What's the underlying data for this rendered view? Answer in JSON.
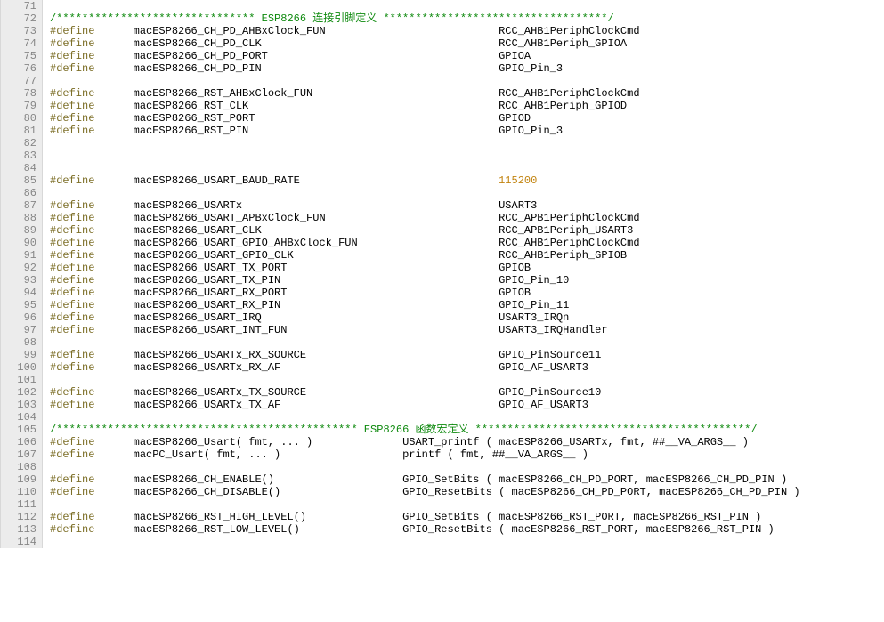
{
  "first_line": 71,
  "lines": [
    {
      "n": 71,
      "raw": ""
    },
    {
      "n": 72,
      "comment": "/******************************* ESP8266 连接引脚定义 ***********************************/"
    },
    {
      "n": 73,
      "def": true,
      "c1": "macESP8266_CH_PD_AHBxClock_FUN",
      "c2": "RCC_AHB1PeriphClockCmd"
    },
    {
      "n": 74,
      "def": true,
      "c1": "macESP8266_CH_PD_CLK",
      "c2": "RCC_AHB1Periph_GPIOA"
    },
    {
      "n": 75,
      "def": true,
      "c1": "macESP8266_CH_PD_PORT",
      "c2": "GPIOA"
    },
    {
      "n": 76,
      "def": true,
      "c1": "macESP8266_CH_PD_PIN",
      "c2": "GPIO_Pin_3"
    },
    {
      "n": 77,
      "raw": ""
    },
    {
      "n": 78,
      "def": true,
      "c1": "macESP8266_RST_AHBxClock_FUN",
      "c2": "RCC_AHB1PeriphClockCmd"
    },
    {
      "n": 79,
      "def": true,
      "c1": "macESP8266_RST_CLK",
      "c2": "RCC_AHB1Periph_GPIOD"
    },
    {
      "n": 80,
      "def": true,
      "c1": "macESP8266_RST_PORT",
      "c2": "GPIOD"
    },
    {
      "n": 81,
      "def": true,
      "c1": "macESP8266_RST_PIN",
      "c2": "GPIO_Pin_3"
    },
    {
      "n": 82,
      "raw": ""
    },
    {
      "n": 83,
      "raw": ""
    },
    {
      "n": 84,
      "raw": ""
    },
    {
      "n": 85,
      "def": true,
      "c1": "macESP8266_USART_BAUD_RATE",
      "c2": "115200",
      "num": true
    },
    {
      "n": 86,
      "raw": ""
    },
    {
      "n": 87,
      "def": true,
      "c1": "macESP8266_USARTx",
      "c2": "USART3"
    },
    {
      "n": 88,
      "def": true,
      "c1": "macESP8266_USART_APBxClock_FUN",
      "c2": "RCC_APB1PeriphClockCmd"
    },
    {
      "n": 89,
      "def": true,
      "c1": "macESP8266_USART_CLK",
      "c2": "RCC_APB1Periph_USART3"
    },
    {
      "n": 90,
      "def": true,
      "c1": "macESP8266_USART_GPIO_AHBxClock_FUN",
      "c2": "RCC_AHB1PeriphClockCmd"
    },
    {
      "n": 91,
      "def": true,
      "c1": "macESP8266_USART_GPIO_CLK",
      "c2": "RCC_AHB1Periph_GPIOB"
    },
    {
      "n": 92,
      "def": true,
      "c1": "macESP8266_USART_TX_PORT",
      "c2": "GPIOB"
    },
    {
      "n": 93,
      "def": true,
      "c1": "macESP8266_USART_TX_PIN",
      "c2": "GPIO_Pin_10"
    },
    {
      "n": 94,
      "def": true,
      "c1": "macESP8266_USART_RX_PORT",
      "c2": "GPIOB"
    },
    {
      "n": 95,
      "def": true,
      "c1": "macESP8266_USART_RX_PIN",
      "c2": "GPIO_Pin_11"
    },
    {
      "n": 96,
      "def": true,
      "c1": "macESP8266_USART_IRQ",
      "c2": "USART3_IRQn"
    },
    {
      "n": 97,
      "def": true,
      "c1": "macESP8266_USART_INT_FUN",
      "c2": "USART3_IRQHandler"
    },
    {
      "n": 98,
      "raw": ""
    },
    {
      "n": 99,
      "def": true,
      "c1": "macESP8266_USARTx_RX_SOURCE",
      "c2": "GPIO_PinSource11"
    },
    {
      "n": 100,
      "def": true,
      "c1": "macESP8266_USARTx_RX_AF",
      "c2": "GPIO_AF_USART3"
    },
    {
      "n": 101,
      "raw": ""
    },
    {
      "n": 102,
      "def": true,
      "c1": "macESP8266_USARTx_TX_SOURCE",
      "c2": "GPIO_PinSource10"
    },
    {
      "n": 103,
      "def": true,
      "c1": "macESP8266_USARTx_TX_AF",
      "c2": "GPIO_AF_USART3"
    },
    {
      "n": 104,
      "raw": ""
    },
    {
      "n": 105,
      "comment": "/*********************************************** ESP8266 函数宏定义 *******************************************/"
    },
    {
      "n": 106,
      "def": true,
      "c1": "macESP8266_Usart( fmt, ... )",
      "c2": "USART_printf ( macESP8266_USARTx, fmt, ##__VA_ARGS__ )",
      "col2": 55
    },
    {
      "n": 107,
      "def": true,
      "c1": "macPC_Usart( fmt, ... )",
      "c2": "printf ( fmt, ##__VA_ARGS__ )",
      "col2": 55
    },
    {
      "n": 108,
      "raw": ""
    },
    {
      "n": 109,
      "def": true,
      "c1": "macESP8266_CH_ENABLE()",
      "c2": "GPIO_SetBits ( macESP8266_CH_PD_PORT, macESP8266_CH_PD_PIN )",
      "col2": 55
    },
    {
      "n": 110,
      "def": true,
      "c1": "macESP8266_CH_DISABLE()",
      "c2": "GPIO_ResetBits ( macESP8266_CH_PD_PORT, macESP8266_CH_PD_PIN )",
      "col2": 55
    },
    {
      "n": 111,
      "raw": ""
    },
    {
      "n": 112,
      "def": true,
      "c1": "macESP8266_RST_HIGH_LEVEL()",
      "c2": "GPIO_SetBits ( macESP8266_RST_PORT, macESP8266_RST_PIN )",
      "col2": 55
    },
    {
      "n": 113,
      "def": true,
      "c1": "macESP8266_RST_LOW_LEVEL()",
      "c2": "GPIO_ResetBits ( macESP8266_RST_PORT, macESP8266_RST_PIN )",
      "col2": 55
    },
    {
      "n": 114,
      "raw": ""
    }
  ],
  "keyword": "#define",
  "default_col1": 13,
  "default_col2": 70
}
